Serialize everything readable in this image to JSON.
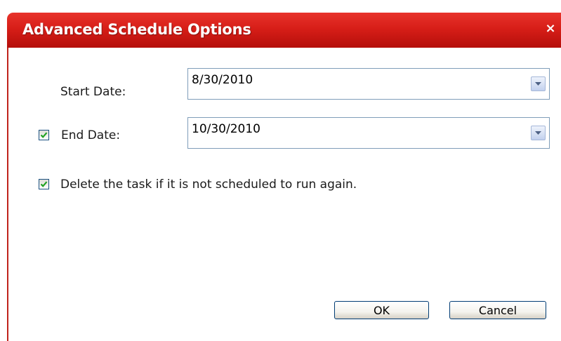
{
  "window": {
    "title": "Advanced Schedule Options",
    "close_label": "×"
  },
  "form": {
    "start_date_label": "Start Date:",
    "start_date_value": "8/30/2010",
    "end_date_label": "End Date:",
    "end_date_value": "10/30/2010",
    "end_date_checked": true,
    "delete_task_label": "Delete the task if it is not scheduled to run again.",
    "delete_task_checked": true
  },
  "buttons": {
    "ok_label": "OK",
    "cancel_label": "Cancel"
  },
  "colors": {
    "title_bar": "#d71e18",
    "title_text": "#ffffff",
    "input_border": "#7f9db9",
    "button_border": "#003c74"
  },
  "icons": {
    "close": "close-icon",
    "dropdown": "chevron-down-icon",
    "check": "checkmark-icon"
  }
}
